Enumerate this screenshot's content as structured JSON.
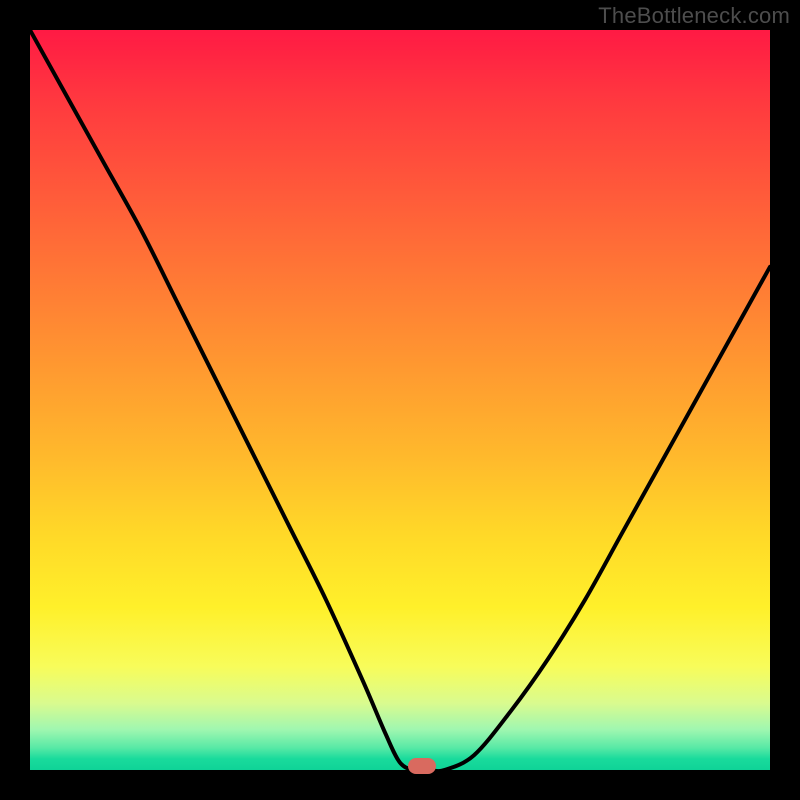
{
  "watermark": "TheBottleneck.com",
  "colors": {
    "frame_bg": "#000000",
    "gradient_top": "#ff1a44",
    "gradient_bottom": "#0fd397",
    "curve_stroke": "#000000",
    "marker_fill": "#d96a5f",
    "watermark_text": "#4d4d4d"
  },
  "chart_data": {
    "type": "line",
    "title": "",
    "xlabel": "",
    "ylabel": "",
    "xlim": [
      0,
      100
    ],
    "ylim": [
      0,
      100
    ],
    "series": [
      {
        "name": "bottleneck-curve",
        "x": [
          0,
          5,
          10,
          15,
          20,
          25,
          30,
          35,
          40,
          45,
          48,
          50,
          52,
          54,
          56,
          60,
          65,
          70,
          75,
          80,
          85,
          90,
          95,
          100
        ],
        "y": [
          100,
          91,
          82,
          73,
          63,
          53,
          43,
          33,
          23,
          12,
          5,
          1,
          0,
          0,
          0,
          2,
          8,
          15,
          23,
          32,
          41,
          50,
          59,
          68
        ]
      }
    ],
    "marker": {
      "x": 53,
      "y": 0.5,
      "name": "optimal-point"
    },
    "background_gradient": {
      "orientation": "vertical",
      "stops": [
        {
          "pos": 0.0,
          "color": "#ff1a44"
        },
        {
          "pos": 0.5,
          "color": "#ffba2c"
        },
        {
          "pos": 0.8,
          "color": "#fff02a"
        },
        {
          "pos": 1.0,
          "color": "#0fd397"
        }
      ]
    }
  }
}
